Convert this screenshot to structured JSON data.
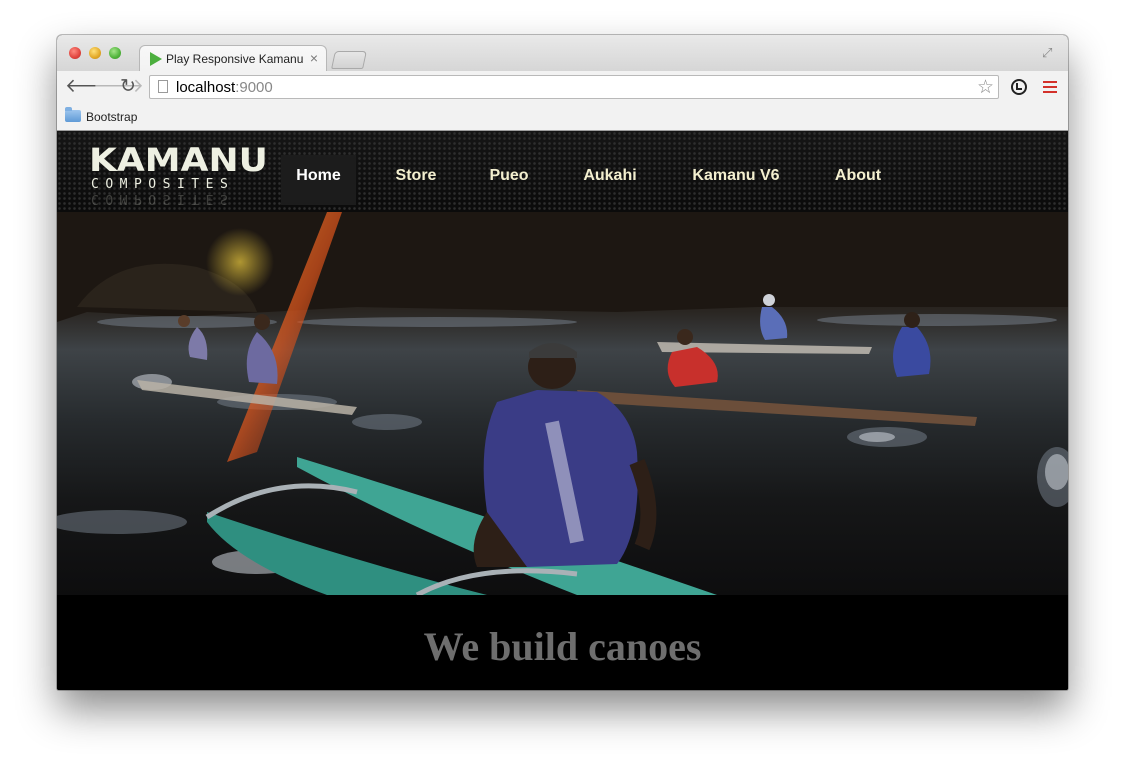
{
  "browser": {
    "tab_title": "Play Responsive Kamanu",
    "tab_close": "×",
    "url_host": "localhost",
    "url_port": ":9000",
    "bookmarks": [
      {
        "label": "Bootstrap"
      }
    ],
    "icons": [
      "back-arrow-icon",
      "forward-arrow-icon",
      "reload-icon",
      "page-icon",
      "star-icon",
      "extension-sync-icon",
      "menu-icon",
      "fullscreen-icon",
      "folder-icon"
    ]
  },
  "site": {
    "logo": {
      "word": "KAMANU",
      "sub": "COMPOSITES"
    },
    "nav": [
      {
        "label": "Home",
        "active": true
      },
      {
        "label": "Store",
        "active": false
      },
      {
        "label": "Pueo",
        "active": false
      },
      {
        "label": "Aukahi",
        "active": false
      },
      {
        "label": "Kamanu V6",
        "active": false
      },
      {
        "label": "About",
        "active": false
      }
    ],
    "tagline": "We build canoes"
  },
  "colors": {
    "nav_text": "#f3efcf",
    "tagline": "#6e6e6e",
    "canoe_teal": "#3fa594",
    "flare": "#e0561c"
  }
}
